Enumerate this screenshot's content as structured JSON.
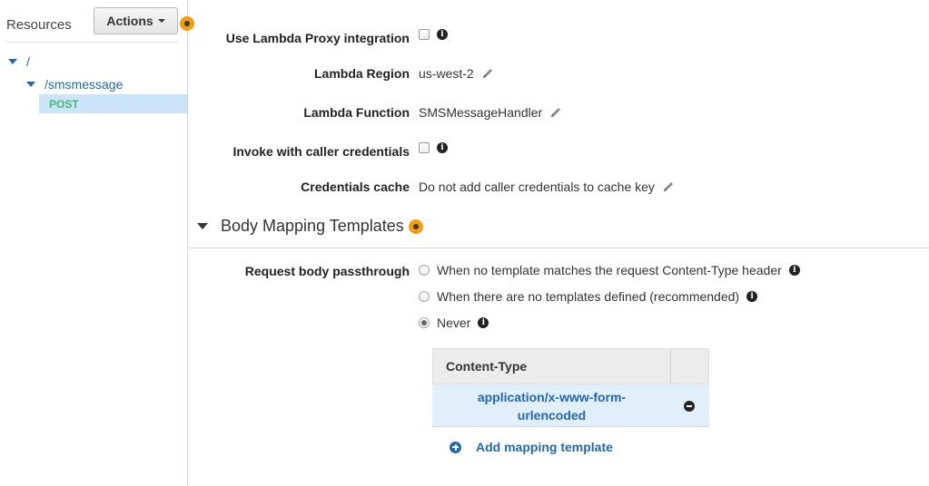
{
  "sidebar": {
    "title": "Resources",
    "actions_label": "Actions",
    "tree": [
      {
        "label": "/"
      },
      {
        "label": "/smsmessage"
      }
    ],
    "selected_method": "POST"
  },
  "integration": {
    "proxy": {
      "label": "Use Lambda Proxy integration",
      "checked": false
    },
    "region": {
      "label": "Lambda Region",
      "value": "us-west-2"
    },
    "function": {
      "label": "Lambda Function",
      "value": "SMSMessageHandler"
    },
    "caller_credentials": {
      "label": "Invoke with caller credentials",
      "checked": false
    },
    "credentials_cache": {
      "label": "Credentials cache",
      "value": "Do not add caller credentials to cache key"
    }
  },
  "body_mapping": {
    "title": "Body Mapping Templates",
    "passthrough_label": "Request body passthrough",
    "options": [
      {
        "label": "When no template matches the request Content-Type header",
        "selected": false
      },
      {
        "label": "When there are no templates defined (recommended)",
        "selected": false
      },
      {
        "label": "Never",
        "selected": true
      }
    ],
    "table": {
      "header": "Content-Type",
      "rows": [
        {
          "content_type": "application/x-www-form-urlencoded"
        }
      ]
    },
    "add_label": "Add mapping template"
  },
  "colors": {
    "accent": "#2167b1",
    "badge_orange": "#f39c12",
    "method_green": "#46b977",
    "selected_bg": "#cce4f7"
  }
}
